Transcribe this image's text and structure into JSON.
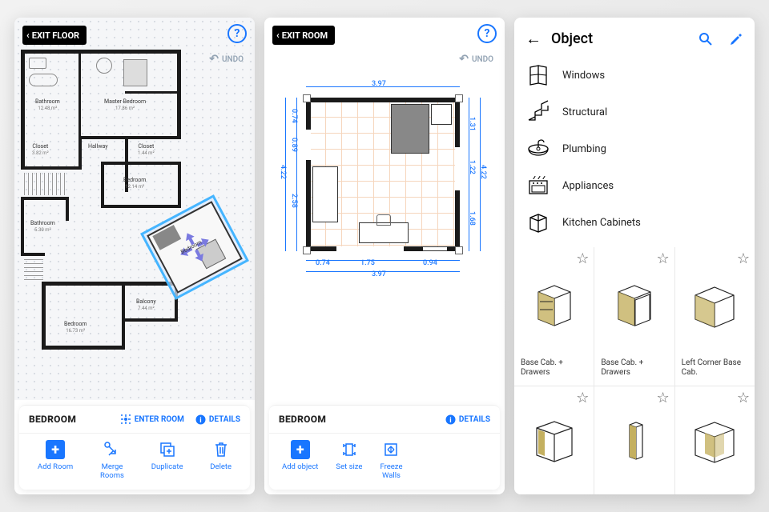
{
  "panel1": {
    "exit_label": "EXIT FLOOR",
    "undo_label": "UNDO",
    "rooms": {
      "bathroom1": {
        "name": "Bathroom",
        "area": "12.48 m²"
      },
      "master_bedroom": {
        "name": "Master Bedroom",
        "area": "17.86 m²"
      },
      "closet1": {
        "name": "Closet",
        "area": "3.82 m²"
      },
      "hallway": {
        "name": "Hallway",
        "area": ""
      },
      "closet2": {
        "name": "Closet",
        "area": "1.44 m²"
      },
      "bedroom1": {
        "name": "Bedroom",
        "area": "12.14 m²"
      },
      "bathroom2": {
        "name": "Bathroom",
        "area": "5.30 m²"
      },
      "bedroom2": {
        "name": "Bedroom",
        "area": "16.73 m²"
      },
      "balcony": {
        "name": "Balcony",
        "area": "7.44 m²"
      },
      "dragging": {
        "name": "Bedroom",
        "area": ""
      }
    },
    "selected_name": "BEDROOM",
    "enter_room_label": "ENTER ROOM",
    "details_label": "DETAILS",
    "toolbar": {
      "add_room": "Add Room",
      "merge_rooms": "Merge\nRooms",
      "duplicate": "Duplicate",
      "delete": "Delete"
    }
  },
  "panel2": {
    "exit_label": "EXIT ROOM",
    "undo_label": "UNDO",
    "dimensions": {
      "top": "3.97",
      "left_top": "0.74",
      "left_mid": "0.89",
      "left_bottom": "2.58",
      "left_total": "4.22",
      "right_top": "1.31",
      "right_mid": "1.22",
      "right_bottom": "1.68",
      "right_total": "4.22",
      "bottom_1": "0.74",
      "bottom_2": "1.75",
      "bottom_3": "0.94",
      "bottom_total": "3.97"
    },
    "selected_name": "BEDROOM",
    "details_label": "DETAILS",
    "toolbar": {
      "add_object": "Add object",
      "set_size": "Set size",
      "freeze_walls": "Freeze\nWalls"
    }
  },
  "panel3": {
    "title": "Object",
    "categories": [
      {
        "label": "Windows",
        "icon": "windows"
      },
      {
        "label": "Structural",
        "icon": "structural"
      },
      {
        "label": "Plumbing",
        "icon": "plumbing"
      },
      {
        "label": "Appliances",
        "icon": "appliances"
      },
      {
        "label": "Kitchen Cabinets",
        "icon": "cabinets"
      }
    ],
    "objects": [
      {
        "name": "Base Cab. + Drawers"
      },
      {
        "name": "Base Cab. + Drawers"
      },
      {
        "name": "Left Corner Base Cab."
      },
      {
        "name": ""
      },
      {
        "name": ""
      },
      {
        "name": ""
      }
    ]
  }
}
